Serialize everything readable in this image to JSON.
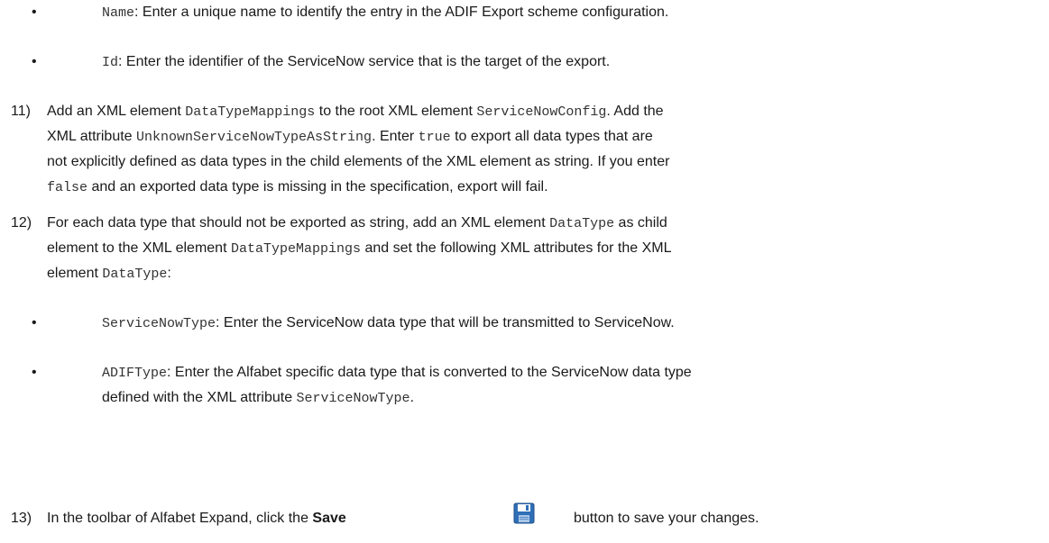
{
  "bullets_top": [
    {
      "code": "Name",
      "text": ": Enter a unique name to identify the entry in the ADIF Export scheme configuration."
    },
    {
      "code": "Id",
      "text": ": Enter the identifier of the ServiceNow service that is the target of the export."
    }
  ],
  "step11": {
    "number": "11)",
    "l1_a": "Add an XML element ",
    "l1_c1": "DataTypeMappings",
    "l1_b": " to the root XML element ",
    "l1_c2": "ServiceNowConfig",
    "l1_c": ". Add the",
    "l2_a": "XML attribute ",
    "l2_c1": "UnknownServiceNowTypeAsString",
    "l2_b": ". Enter ",
    "l2_c2": "true",
    "l2_c": " to export all data types that are",
    "l3": "not explicitly defined as data types in the child elements of the XML element as string. If you enter",
    "l4_c1": "false",
    "l4_a": " and an exported data type is missing in the specification, export will fail."
  },
  "step12": {
    "number": "12)",
    "l1_a": "For each data type that should not be exported as string, add an XML element ",
    "l1_c1": "DataType",
    "l1_b": " as child",
    "l2_a": "element to the XML element ",
    "l2_c1": "DataTypeMappings",
    "l2_b": " and set the following XML attributes for the XML",
    "l3_a": "element ",
    "l3_c1": "DataType",
    "l3_b": ":"
  },
  "bullets_bottom": {
    "b1_code": "ServiceNowType",
    "b1_text": ": Enter the ServiceNow data type that will be transmitted to ServiceNow.",
    "b2_code": "ADIFType",
    "b2_text": ": Enter the Alfabet specific data type that is converted to the ServiceNow data type",
    "b2_l2_a": "defined with the XML attribute ",
    "b2_l2_code": "ServiceNowType",
    "b2_l2_b": "."
  },
  "step13": {
    "number": "13)",
    "text_a": "In the toolbar of Alfabet Expand, click the ",
    "bold": "Save",
    "text_b": "button to save your changes.",
    "icon": "floppy-disk-save-icon"
  },
  "colors": {
    "text": "#1a1a1a",
    "code": "#333333",
    "icon_blue": "#2f6fb7"
  }
}
